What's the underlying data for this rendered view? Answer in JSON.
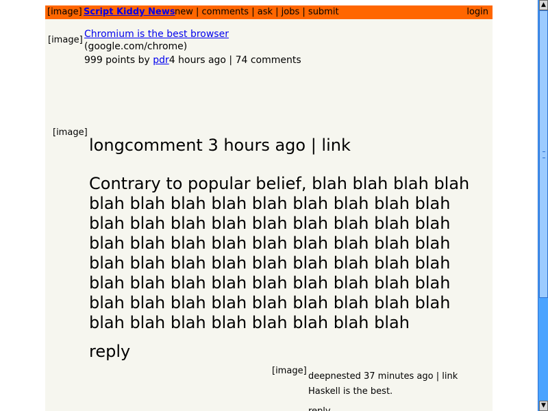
{
  "header": {
    "logo_alt": "[image]",
    "site_name": "Script Kiddy News",
    "nav": [
      "new",
      "comments",
      "ask",
      "jobs",
      "submit"
    ],
    "login": "login"
  },
  "story": {
    "image_alt": "[image]",
    "title": "Chromium is the best browser",
    "domain": "(google.com/chrome)",
    "points": "999 points by",
    "user": "pdr",
    "age_comments": "4 hours ago | 74 comments"
  },
  "comments": [
    {
      "image_alt": "[image]",
      "header": "longcomment 3 hours ago | link",
      "text": "Contrary to popular belief, blah blah blah blah blah blah blah blah blah blah blah blah blah blah blah blah blah blah blah blah blah blah blah blah blah blah blah blah blah blah blah blah blah blah blah blah blah blah blah blah blah blah blah blah blah blah blah blah blah blah blah blah blah blah blah blah blah blah blah blah blah blah blah blah blah blah",
      "reply": "reply"
    },
    {
      "image_alt": "[image]",
      "header": "deepnested 37 minutes ago | link",
      "text": "Haskell is the best.",
      "reply": "reply"
    }
  ],
  "scrollbar": {
    "up_icon": "▲",
    "down_icon": "▼"
  }
}
